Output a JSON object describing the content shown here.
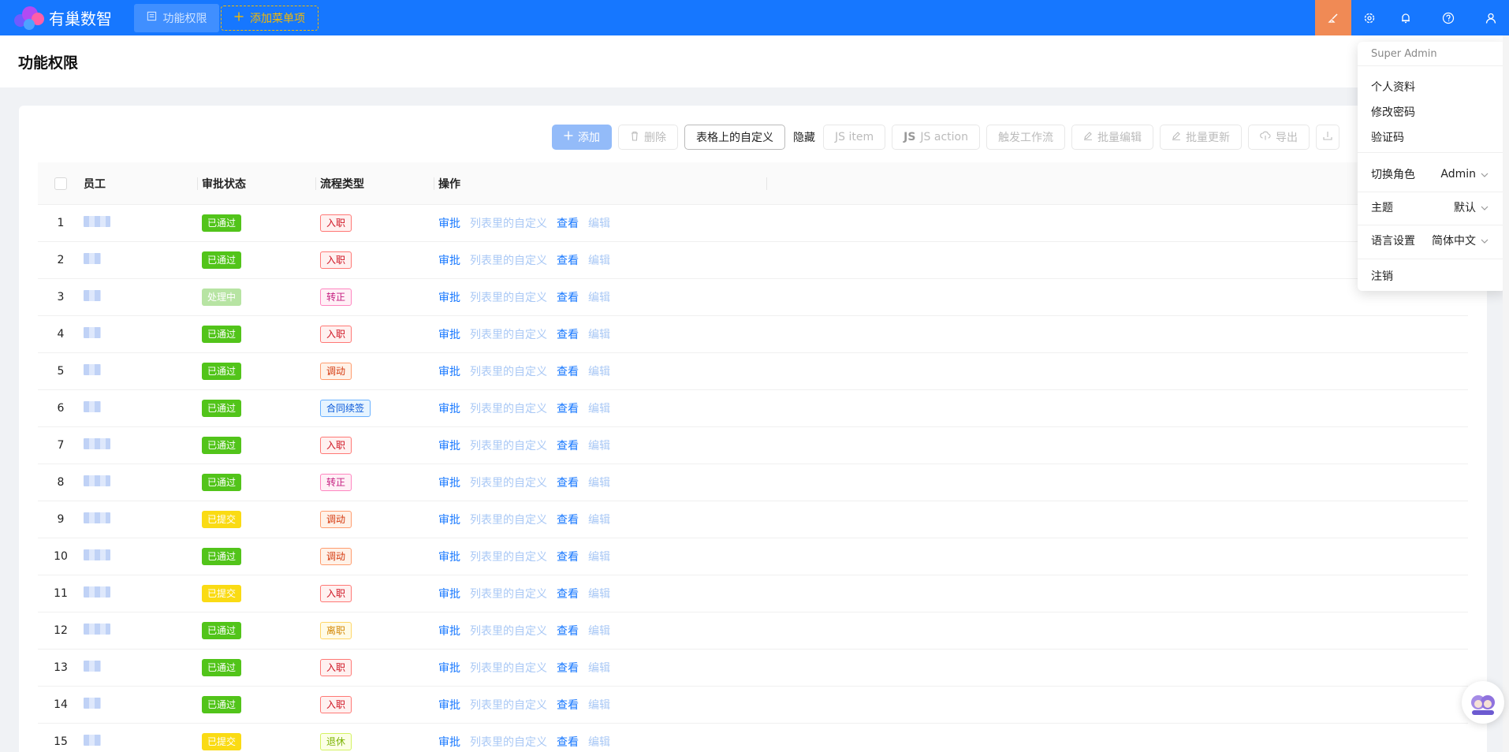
{
  "app": {
    "name": "有巢数智"
  },
  "tabs": {
    "active": "功能权限",
    "add": "添加菜单项"
  },
  "page": {
    "title": "功能权限"
  },
  "toolbar": {
    "add": "添加",
    "delete": "删除",
    "custom_on_table": "表格上的自定义",
    "hide": "隐藏",
    "js_item": "JS item",
    "js_action": "JS action",
    "trigger_workflow": "触发工作流",
    "batch_edit": "批量编辑",
    "batch_update": "批量更新",
    "export": "导出"
  },
  "table": {
    "headers": {
      "employee": "员工",
      "status": "审批状态",
      "flow": "流程类型",
      "actions": "操作"
    },
    "action_labels": {
      "approve": "审批",
      "custom": "列表里的自定义",
      "view": "查看",
      "edit": "编辑"
    },
    "rows": [
      {
        "index": "1",
        "status": "已通过",
        "flow": "入职"
      },
      {
        "index": "2",
        "status": "已通过",
        "flow": "入职"
      },
      {
        "index": "3",
        "status": "处理中",
        "flow": "转正"
      },
      {
        "index": "4",
        "status": "已通过",
        "flow": "入职"
      },
      {
        "index": "5",
        "status": "已通过",
        "flow": "调动"
      },
      {
        "index": "6",
        "status": "已通过",
        "flow": "合同续签"
      },
      {
        "index": "7",
        "status": "已通过",
        "flow": "入职"
      },
      {
        "index": "8",
        "status": "已通过",
        "flow": "转正"
      },
      {
        "index": "9",
        "status": "已提交",
        "flow": "调动"
      },
      {
        "index": "10",
        "status": "已通过",
        "flow": "调动"
      },
      {
        "index": "11",
        "status": "已提交",
        "flow": "入职"
      },
      {
        "index": "12",
        "status": "已通过",
        "flow": "离职"
      },
      {
        "index": "13",
        "status": "已通过",
        "flow": "入职"
      },
      {
        "index": "14",
        "status": "已通过",
        "flow": "入职"
      },
      {
        "index": "15",
        "status": "已提交",
        "flow": "退休"
      }
    ]
  },
  "status_colors": {
    "已通过": "#52c41a",
    "处理中": "#b7e4a3",
    "已提交": "#fadb14"
  },
  "flow_colors": {
    "入职": {
      "color": "#cf1322",
      "border": "#ff7875",
      "bg": "#fff1f0"
    },
    "转正": {
      "color": "#c41d7f",
      "border": "#ff85c0",
      "bg": "#fff0f6"
    },
    "调动": {
      "color": "#d4380d",
      "border": "#ff9c6e",
      "bg": "#fff2e8"
    },
    "合同续签": {
      "color": "#0958d9",
      "border": "#69b1ff",
      "bg": "#e6f4ff"
    },
    "离职": {
      "color": "#d48806",
      "border": "#ffd666",
      "bg": "#fffbe6"
    },
    "退休": {
      "color": "#7cb305",
      "border": "#d3f261",
      "bg": "#fcffe6"
    }
  },
  "user_menu": {
    "user": "Super Admin",
    "profile": "个人资料",
    "change_password": "修改密码",
    "verification_code": "验证码",
    "switch_role_label": "切换角色",
    "switch_role_value": "Admin",
    "theme_label": "主题",
    "theme_value": "默认",
    "language_label": "语言设置",
    "language_value": "简体中文",
    "logout": "注销"
  },
  "colors": {
    "topbar": "#1677ff",
    "accent_orange": "#f08a55",
    "link": "#1677ff"
  },
  "icons": [
    "logo-icon",
    "menu-page-icon",
    "plus-icon",
    "paint-brush-icon",
    "gear-icon",
    "bell-icon",
    "help-icon",
    "user-icon",
    "trash-icon",
    "edit-icon",
    "cloud-download-icon",
    "chevron-down-icon",
    "assistant-avatar-icon"
  ]
}
